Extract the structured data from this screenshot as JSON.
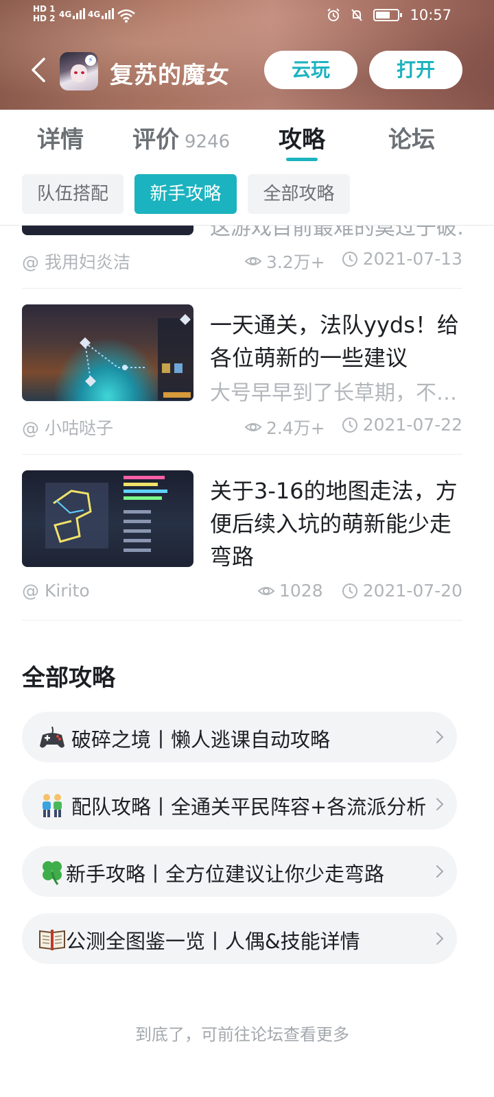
{
  "status_bar": {
    "hd1": "HD 1",
    "hd2": "HD 2",
    "signal1": "4G",
    "signal2": "4G",
    "time": "10:57"
  },
  "header": {
    "app_title": "复苏的魔女",
    "cloud_play_label": "云玩",
    "open_label": "打开"
  },
  "tabs": [
    {
      "label": "详情"
    },
    {
      "label": "评价",
      "count": "9246"
    },
    {
      "label": "攻略"
    },
    {
      "label": "论坛"
    }
  ],
  "chips": [
    "队伍搭配",
    "新手攻略",
    "全部攻略"
  ],
  "partial_article": {
    "text": "这游戏目前最难的莫过于破…",
    "author": "@ 我用妇炎洁",
    "views": "3.2万+",
    "date": "2021-07-13"
  },
  "articles": [
    {
      "title": "一天通关，法队yyds！给各位萌新的一些建议",
      "subtitle": "大号早早到了长草期，不…",
      "author": "@ 小咕哒子",
      "views": "2.4万+",
      "date": "2021-07-22"
    },
    {
      "title": "关于3-16的地图走法，方便后续入坑的萌新能少走弯路",
      "subtitle": "",
      "author": "@ Kirito",
      "views": "1028",
      "date": "2021-07-20"
    }
  ],
  "all_guides": {
    "title": "全部攻略",
    "items": [
      {
        "icon": "gamepad-icon",
        "label": "破碎之境丨懒人逃课自动攻略"
      },
      {
        "icon": "two-people-icon",
        "label": "配队攻略丨全通关平民阵容+各流派分析"
      },
      {
        "icon": "four-leaf-clover-icon",
        "label": "新手攻略丨全方位建议让你少走弯路"
      },
      {
        "icon": "open-book-icon",
        "label": "公测全图鉴一览丨人偶&技能详情"
      }
    ]
  },
  "footer": {
    "text": "到底了，可前往论坛查看更多"
  },
  "colors": {
    "accent": "#1bb3bf",
    "muted": "#a3a8ad",
    "header_bg": "#a56f62"
  }
}
